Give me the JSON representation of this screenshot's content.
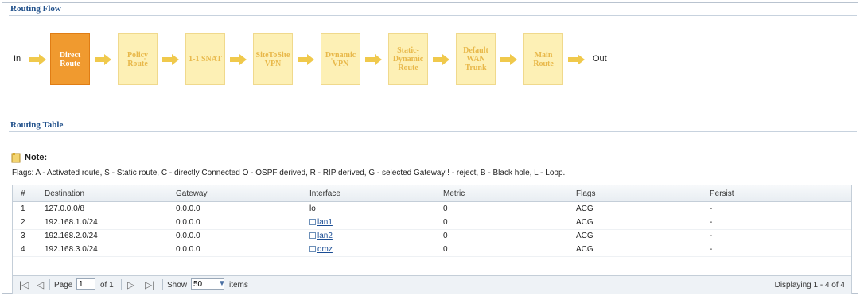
{
  "routing_flow": {
    "title": "Routing Flow",
    "start": "In",
    "end": "Out",
    "steps": [
      {
        "label": "Direct\nRoute",
        "active": true
      },
      {
        "label": "Policy\nRoute",
        "active": false
      },
      {
        "label": "1-1 SNAT",
        "active": false
      },
      {
        "label": "SiteToSite\nVPN",
        "active": false
      },
      {
        "label": "Dynamic\nVPN",
        "active": false
      },
      {
        "label": "Static-\nDynamic\nRoute",
        "active": false
      },
      {
        "label": "Default\nWAN\nTrunk",
        "active": false
      },
      {
        "label": "Main\nRoute",
        "active": false
      }
    ],
    "colors": {
      "active": "#f09a2f",
      "inactive": "#fdf0b5",
      "arrow": "#f0c94c"
    }
  },
  "routing_table": {
    "title": "Routing Table",
    "note_title": "Note:",
    "flags_text": "Flags: A - Activated route, S - Static route, C - directly Connected O - OSPF derived, R - RIP derived, G - selected Gateway ! - reject, B - Black hole, L - Loop.",
    "columns": [
      "#",
      "Destination",
      "Gateway",
      "Interface",
      "Metric",
      "Flags",
      "Persist"
    ],
    "rows": [
      {
        "num": "1",
        "destination": "127.0.0.0/8",
        "gateway": "0.0.0.0",
        "interface": "lo",
        "iface_link": false,
        "metric": "0",
        "flags": "ACG",
        "persist": "-"
      },
      {
        "num": "2",
        "destination": "192.168.1.0/24",
        "gateway": "0.0.0.0",
        "interface": "lan1",
        "iface_link": true,
        "metric": "0",
        "flags": "ACG",
        "persist": "-"
      },
      {
        "num": "3",
        "destination": "192.168.2.0/24",
        "gateway": "0.0.0.0",
        "interface": "lan2",
        "iface_link": true,
        "metric": "0",
        "flags": "ACG",
        "persist": "-"
      },
      {
        "num": "4",
        "destination": "192.168.3.0/24",
        "gateway": "0.0.0.0",
        "interface": "dmz",
        "iface_link": true,
        "metric": "0",
        "flags": "ACG",
        "persist": "-"
      }
    ],
    "pager": {
      "page_label": "Page",
      "page_value": "1",
      "of_label": "of 1",
      "show_label": "Show",
      "show_value": "50",
      "items_label": "items",
      "displaying": "Displaying 1 - 4 of 4"
    }
  }
}
